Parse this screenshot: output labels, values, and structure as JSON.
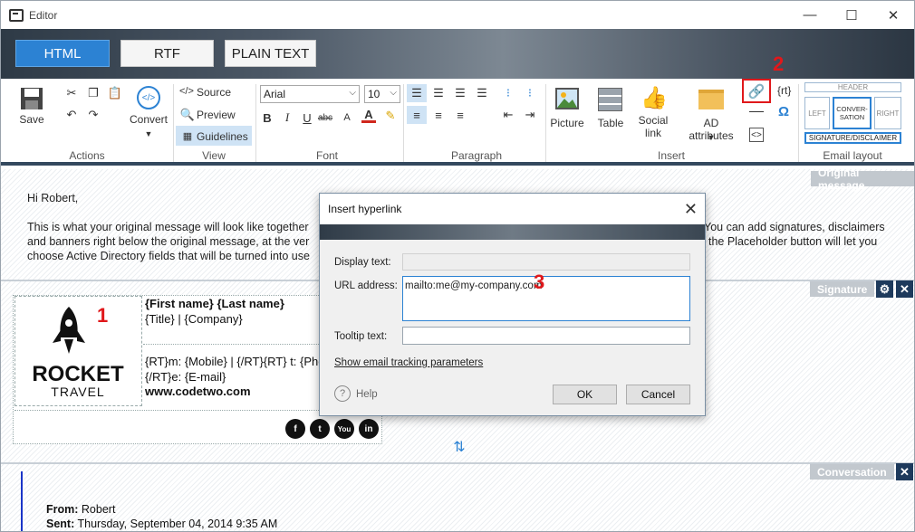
{
  "window": {
    "title": "Editor",
    "minimize": "—",
    "maximize": "☐",
    "close": "✕"
  },
  "format_tabs": [
    {
      "label": "HTML",
      "active": true
    },
    {
      "label": "RTF",
      "active": false
    },
    {
      "label": "PLAIN TEXT",
      "active": false
    }
  ],
  "ribbon": {
    "actions": {
      "save": "Save",
      "convert": "Convert",
      "group": "Actions"
    },
    "view": {
      "source": "Source",
      "preview": "Preview",
      "guidelines": "Guidelines",
      "group": "View"
    },
    "font": {
      "family": "Arial",
      "size": "10",
      "group": "Font"
    },
    "paragraph": {
      "group": "Paragraph"
    },
    "insert": {
      "picture": "Picture",
      "table": "Table",
      "social_link": "Social link",
      "ad_attributes": "AD attributes",
      "rt": "{rt}",
      "omega": "Ω",
      "group": "Insert"
    },
    "email_layout": {
      "header": "HEADER",
      "left": "LEFT",
      "conversation": "CONVER-SATION",
      "right": "RIGHT",
      "signature": "SIGNATURE/DISCLAIMER",
      "group": "Email layout"
    }
  },
  "sections": {
    "original": "Original message",
    "signature": "Signature",
    "conversation": "Conversation"
  },
  "original_message": {
    "greeting": "Hi Robert,",
    "line1a": "This is what your original message will look like together",
    "line1b": "You can add signatures, disclaimers",
    "line2a": "and banners right below the original message, at the ver",
    "line2b": "the Placeholder button will let you",
    "line3a": "choose Active Directory fields that will be turned into use"
  },
  "signature": {
    "logo_word1": "ROCKET",
    "logo_word2": "TRAVEL",
    "name": "{First name} {Last name}",
    "title": "{Title} | {Company}",
    "phone": "{RT}m: {Mobile} | {/RT}{RT} t: {Pho",
    "email": "{/RT}e: {E-mail}",
    "website": "www.codetwo.com",
    "social": [
      "f",
      "t",
      "You",
      "in"
    ]
  },
  "conversation": {
    "from_label": "From:",
    "from_value": "Robert",
    "sent_label": "Sent:",
    "sent_value": "Thursday, September 04, 2014 9:35 AM"
  },
  "callouts": {
    "one": "1",
    "two": "2",
    "three": "3"
  },
  "dialog": {
    "title": "Insert hyperlink",
    "display_text_label": "Display text:",
    "display_text_value": "",
    "url_label": "URL address:",
    "url_value": "mailto:me@my-company.com",
    "tooltip_label": "Tooltip text:",
    "tooltip_value": "",
    "tracking_link": "Show email tracking parameters",
    "help": "Help",
    "ok": "OK",
    "cancel": "Cancel"
  },
  "colors": {
    "accent": "#2c82d3",
    "navy": "#1e3a5c",
    "callout": "#e0181b",
    "tag": "#c2c8ce"
  }
}
